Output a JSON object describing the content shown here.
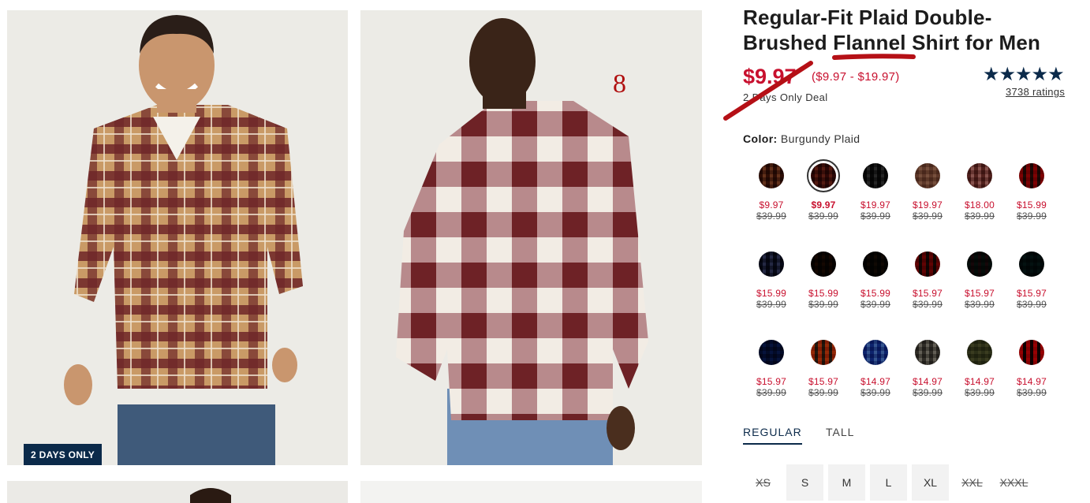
{
  "gallery": {
    "badge": "2 DAYS ONLY",
    "annotation_number": "8"
  },
  "product": {
    "title_line1": "Regular-Fit Plaid Double-",
    "title_line2_a": "Brushed ",
    "title_line2_b": "Flannel",
    "title_line2_c": " Shirt for Men",
    "price": "$9.97",
    "price_range": "($9.97 - $19.97)",
    "deal": "2 Days Only Deal",
    "stars": "★★★★★",
    "ratings": "3738 ratings",
    "rating_value": 5
  },
  "color": {
    "label": "Color:",
    "value": "Burgundy Plaid",
    "swatches": [
      {
        "sale": "$9.97",
        "orig": "$39.99",
        "colors": [
          "#6b3a24",
          "#e9d7bd"
        ]
      },
      {
        "sale": "$9.97",
        "orig": "$39.99",
        "colors": [
          "#6a2a26",
          "#caa47a"
        ],
        "selected": true
      },
      {
        "sale": "$19.97",
        "orig": "$39.99",
        "colors": [
          "#2b2b2b",
          "#dcdcdc"
        ]
      },
      {
        "sale": "$19.97",
        "orig": "$39.99",
        "colors": [
          "#9a7866",
          "#c4a796"
        ]
      },
      {
        "sale": "$18.00",
        "orig": "$39.99",
        "colors": [
          "#8f5a55",
          "#efe8e6"
        ]
      },
      {
        "sale": "$15.99",
        "orig": "$39.99",
        "colors": [
          "#b3161c",
          "#2a6b3a"
        ]
      },
      {
        "sale": "$15.99",
        "orig": "$39.99",
        "colors": [
          "#2a2f4d",
          "#d9d9de"
        ]
      },
      {
        "sale": "$15.99",
        "orig": "$39.99",
        "colors": [
          "#2b1a12",
          "#7a4a22"
        ]
      },
      {
        "sale": "$15.99",
        "orig": "$39.99",
        "colors": [
          "#1e1a18",
          "#8a5a26"
        ]
      },
      {
        "sale": "$15.97",
        "orig": "$39.99",
        "colors": [
          "#9d1a1a",
          "#1d3d2a"
        ]
      },
      {
        "sale": "$15.97",
        "orig": "$39.99",
        "colors": [
          "#223b36",
          "#a3202a"
        ]
      },
      {
        "sale": "$15.97",
        "orig": "$39.99",
        "colors": [
          "#163236",
          "#2a5a52"
        ]
      },
      {
        "sale": "$15.97",
        "orig": "$39.99",
        "colors": [
          "#1a3564",
          "#3a5a9a"
        ]
      },
      {
        "sale": "$15.97",
        "orig": "$39.99",
        "colors": [
          "#c2662a",
          "#2d3a5a"
        ]
      },
      {
        "sale": "$14.97",
        "orig": "$39.99",
        "colors": [
          "#3a5fa6",
          "#e8e2da"
        ]
      },
      {
        "sale": "$14.97",
        "orig": "$39.99",
        "colors": [
          "#6d6a63",
          "#e5e2dc"
        ]
      },
      {
        "sale": "$14.97",
        "orig": "$39.99",
        "colors": [
          "#6a6e4e",
          "#8c8a6a"
        ]
      },
      {
        "sale": "$14.97",
        "orig": "$39.99",
        "colors": [
          "#c4111a",
          "#141414"
        ]
      }
    ]
  },
  "fit_tabs": [
    {
      "label": "REGULAR",
      "active": true
    },
    {
      "label": "TALL",
      "active": false
    }
  ],
  "sizes": [
    {
      "label": "XS",
      "available": false
    },
    {
      "label": "S",
      "available": true
    },
    {
      "label": "M",
      "available": true
    },
    {
      "label": "L",
      "available": true
    },
    {
      "label": "XL",
      "available": true
    },
    {
      "label": "XXL",
      "available": false
    },
    {
      "label": "XXXL",
      "available": false
    }
  ]
}
